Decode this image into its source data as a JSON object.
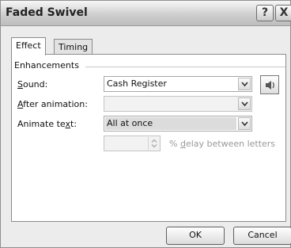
{
  "window": {
    "title": "Faded Swivel",
    "help_glyph": "?",
    "close_glyph": "X"
  },
  "tabs": [
    {
      "label": "Effect",
      "active": true
    },
    {
      "label": "Timing",
      "active": false
    }
  ],
  "enhancements": {
    "group_label": "Enhancements",
    "sound": {
      "label_pre": "",
      "label_key": "S",
      "label_post": "ound:",
      "value": "Cash Register"
    },
    "after_animation": {
      "label_pre": "",
      "label_key": "A",
      "label_post": "fter animation:",
      "value": ""
    },
    "animate_text": {
      "label_pre": "Animate te",
      "label_key": "x",
      "label_post": "t:",
      "value": "All at once"
    },
    "delay": {
      "value": "",
      "label_pre": "% ",
      "label_key": "d",
      "label_post": "elay between letters"
    }
  },
  "buttons": {
    "ok": "OK",
    "cancel": "Cancel"
  },
  "icons": {
    "speaker": "speaker-icon",
    "dropdown": "chevron-down-icon",
    "spinner": "spinner-arrows-icon"
  }
}
